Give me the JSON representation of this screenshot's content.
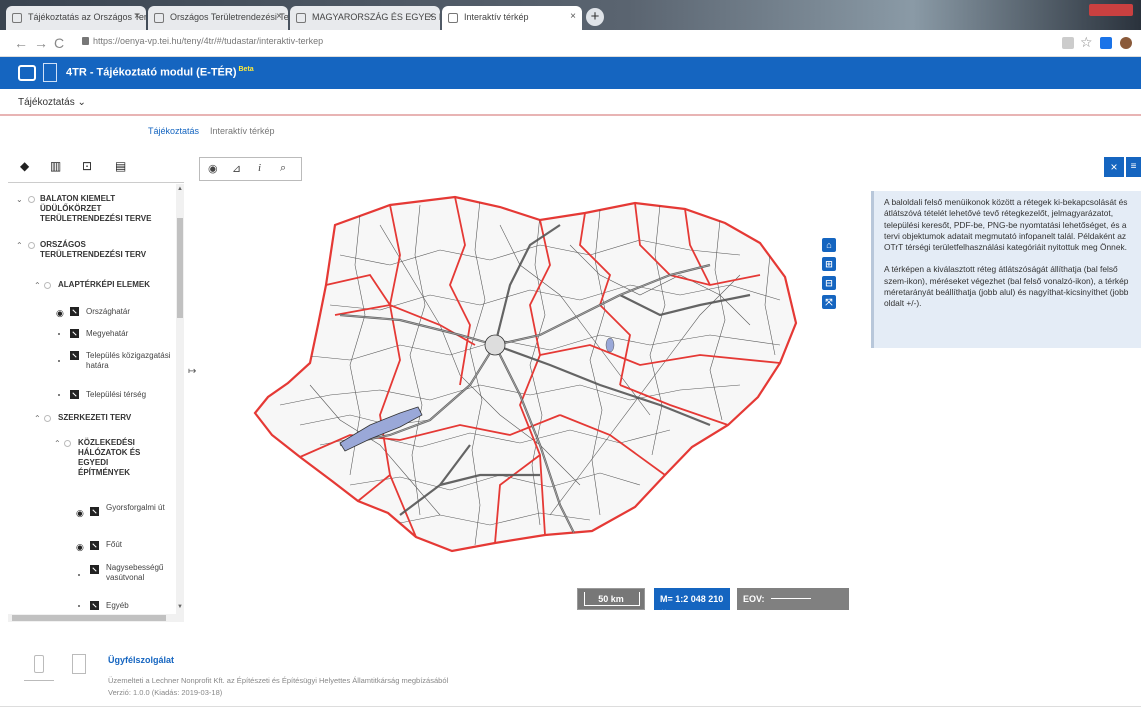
{
  "browser": {
    "tabs": [
      {
        "label": "Tájékoztatás az Országos Terüle..."
      },
      {
        "label": "Országos Területrendezési Terv..."
      },
      {
        "label": "MAGYARORSZÁG ÉS EGYES KIE..."
      },
      {
        "label": "Interaktív térkép"
      }
    ],
    "url": "https://oenya-vp.tei.hu/teny/4tr/#/tudastar/interaktiv-terkep"
  },
  "header": {
    "title": "4TR - Tájékoztató modul (E-TÉR)",
    "beta": "Beta"
  },
  "menu": {
    "item": "Tájékoztatás"
  },
  "subtabs": [
    "Tájékoztatás",
    "Interaktív térkép"
  ],
  "tree": {
    "nodes": [
      {
        "label": "BALATON KIEMELT ÜDÜLŐKÖRZET TERÜLETRENDEZÉSI TERVE"
      },
      {
        "label": "ORSZÁGOS TERÜLETRENDEZÉSI TERV"
      },
      {
        "label": "ALAPTÉRKÉPI ELEMEK"
      },
      {
        "label": "SZERKEZETI TERV"
      },
      {
        "label": "KÖZLEKEDÉSI HÁLÓZATOK ÉS EGYEDI ÉPÍTMÉNYEK"
      }
    ],
    "leaves": [
      {
        "label": "Országhatár"
      },
      {
        "label": "Megyehatár"
      },
      {
        "label": "Település közigazgatási határa"
      },
      {
        "label": "Települési térség"
      },
      {
        "label": "Gyorsforgalmi út"
      },
      {
        "label": "Főút"
      },
      {
        "label": "Nagysebességű vasútvonal"
      },
      {
        "label": "Egyéb"
      }
    ]
  },
  "map": {
    "scale_km": "50 km",
    "scale_ratio": "M= 1:2 048 210",
    "eov_label": "EOV:"
  },
  "info": {
    "p1": "A baloldali felső menüikonok között a rétegek ki-bekapcsolását és átlátszóvá tételét lehetővé tevő rétegkezelőt, jelmagyarázatot, települési keresőt, PDF-be, PNG-be nyomtatási lehetőséget, és a tervi objektumok adatait megmutató infopanelt talál. Példaként az OTrT térségi területfelhasználási kategóriáit nyitottuk meg Önnek.",
    "p2": "A térképen a kiválasztott réteg átlátszóságát állíthatja (bal felső szem-ikon), méréseket végezhet (bal felső vonalzó-ikon), a térkép méretarányát beállíthatja (jobb alul) és nagyíthat-kicsinyíthet (jobb oldalt +/-)."
  },
  "footer": {
    "title": "Ügyfélszolgálat",
    "line1": "Üzemelteti a Lechner Nonprofit Kft. az Építészeti és Építésügyi Helyettes Államtitkárság megbízásából",
    "line2": "Verzió: 1.0.0 (Kiadás: 2019-03-18)"
  },
  "colors": {
    "brand": "#1565c0",
    "county_border": "#e53935",
    "lake": "#9aa8d8"
  }
}
